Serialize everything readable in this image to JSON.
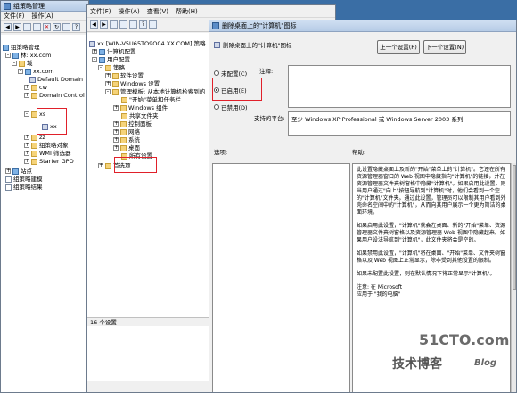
{
  "gpmc": {
    "title": "组策略管理",
    "tree": [
      {
        "label": "组策略管理",
        "icon": "gpmc-icon"
      },
      {
        "label": "林: xx.com",
        "icon": "forest-icon"
      },
      {
        "label": "域",
        "icon": "domains-icon"
      },
      {
        "label": "xx.com",
        "icon": "domain-icon"
      },
      {
        "label": "Default Domain",
        "icon": "gpo-link-icon"
      },
      {
        "label": "cw",
        "icon": "ou-icon"
      },
      {
        "label": "Domain Control",
        "icon": "ou-icon"
      },
      {
        "label": "xs",
        "icon": "ou-icon"
      },
      {
        "label": "xx",
        "icon": "gpo-link-icon"
      },
      {
        "label": "zz",
        "icon": "ou-icon"
      },
      {
        "label": "组策略对象",
        "icon": "folder-icon"
      },
      {
        "label": "WMI 筛选器",
        "icon": "folder-icon"
      },
      {
        "label": "Starter GPO",
        "icon": "folder-icon"
      },
      {
        "label": "站点",
        "icon": "sites-icon"
      },
      {
        "label": "组策略建模",
        "icon": "modeling-icon"
      },
      {
        "label": "组策略结果",
        "icon": "results-icon"
      }
    ]
  },
  "editor": {
    "menu": [
      "文件(F)",
      "操作(A)",
      "查看(V)",
      "帮助(H)"
    ],
    "root": "xx [WIN-V5U65TO9O04.XX.COM] 策略",
    "tree": [
      {
        "label": "计算机配置"
      },
      {
        "label": "用户配置"
      },
      {
        "label": "策略"
      },
      {
        "label": "软件设置"
      },
      {
        "label": "Windows 设置"
      },
      {
        "label": "管理模板: 从本地计算机检索到的"
      },
      {
        "label": "\"开始\"菜单和任务栏"
      },
      {
        "label": "Windows 组件"
      },
      {
        "label": "共享文件夹"
      },
      {
        "label": "控制面板"
      },
      {
        "label": "网络"
      },
      {
        "label": "系统"
      },
      {
        "label": "桌面"
      },
      {
        "label": "所有设置"
      },
      {
        "label": "首选项"
      }
    ],
    "status": "16 个设置"
  },
  "dialog": {
    "title": "删除桌面上的\"计算机\"图标",
    "setting_name": "删除桌面上的\"计算机\"图标",
    "prev_button": "上一个设置(P)",
    "next_button": "下一个设置(N)",
    "options": {
      "not_configured": "未配置(C)",
      "enabled": "已启用(E)",
      "disabled": "已禁用(D)",
      "selected": "enabled"
    },
    "comment_label": "注释:",
    "supported_label": "支持的平台:",
    "supported_value": "至少 Windows XP Professional 或 Windows Server 2003 系列",
    "options_label": "选项:",
    "help_label": "帮助:",
    "help_paragraphs": [
      "此设置隐藏桌面上及新的\"开始\"菜单上的\"计算机\"。它还在所有资源管理器窗口的 Web 视图中隐藏指向\"计算机\"的链接，并在资源管理器文件夹树窗格中隐藏\"计算机\"。如果启用此设置，则当用户通过\"向上\"按钮导航到\"计算机\"时，他们会看到一个空的\"计算机\"文件夹。通过此设置，管理员可以限制其用户看到外壳命名空间中的\"计算机\"，从而向其用户展示一个更为简洁的桌面环境。",
      "如果启用此设置，\"计算机\"就会在桌面、新的\"开始\"菜单、资源管理器文件夹树窗格以及资源管理器 Web 视图中隐藏起来。如果用户设法导航到\"计算机\"，此文件夹将会是空的。",
      "如果禁用此设置，\"计算机\"将在桌面、\"开始\"菜单、文件夹树窗格以及 Web 视图上正常显示，除非受到其他设置的限制。",
      "如果未配置此设置，则在默认情况下将正常显示\"计算机\"。",
      "注意: 在 Microsoft",
      "应用于 \"我的电脑\""
    ]
  },
  "watermark": {
    "site": "51CTO.com",
    "tagline": "技术博客",
    "blog": "Blog"
  }
}
